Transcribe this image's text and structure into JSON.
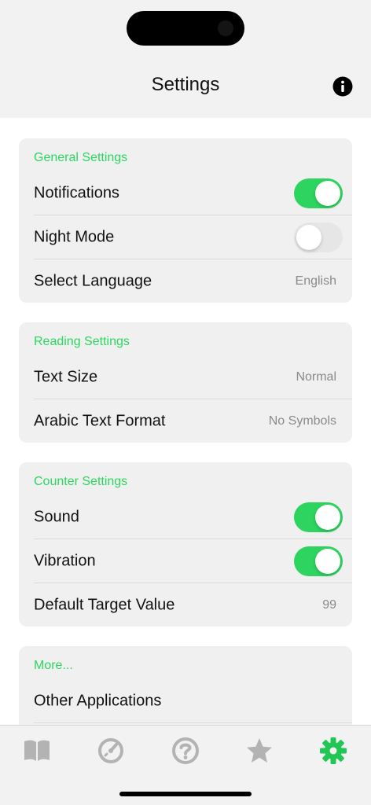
{
  "header": {
    "title": "Settings",
    "info_icon": "info-icon"
  },
  "colors": {
    "accent": "#2bd75f",
    "toggle_on": "#2dd45f",
    "value_gray": "#8a8a8a",
    "tab_inactive": "#b3b3b3"
  },
  "sections": {
    "general": {
      "title": "General Settings",
      "notifications": {
        "label": "Notifications",
        "on": true
      },
      "night_mode": {
        "label": "Night Mode",
        "on": false
      },
      "language": {
        "label": "Select Language",
        "value": "English"
      }
    },
    "reading": {
      "title": "Reading Settings",
      "text_size": {
        "label": "Text Size",
        "value": "Normal"
      },
      "arabic_format": {
        "label": "Arabic Text Format",
        "value": "No Symbols"
      }
    },
    "counter": {
      "title": "Counter Settings",
      "sound": {
        "label": "Sound",
        "on": true
      },
      "vibration": {
        "label": "Vibration",
        "on": true
      },
      "target": {
        "label": "Default Target Value",
        "value": "99"
      }
    },
    "more": {
      "title": "More...",
      "other_apps": {
        "label": "Other Applications"
      }
    }
  },
  "tabbar": {
    "tabs": [
      {
        "icon": "book-icon",
        "active": false
      },
      {
        "icon": "counter-icon",
        "active": false
      },
      {
        "icon": "help-icon",
        "active": false
      },
      {
        "icon": "star-icon",
        "active": false
      },
      {
        "icon": "gear-icon",
        "active": true
      }
    ]
  }
}
